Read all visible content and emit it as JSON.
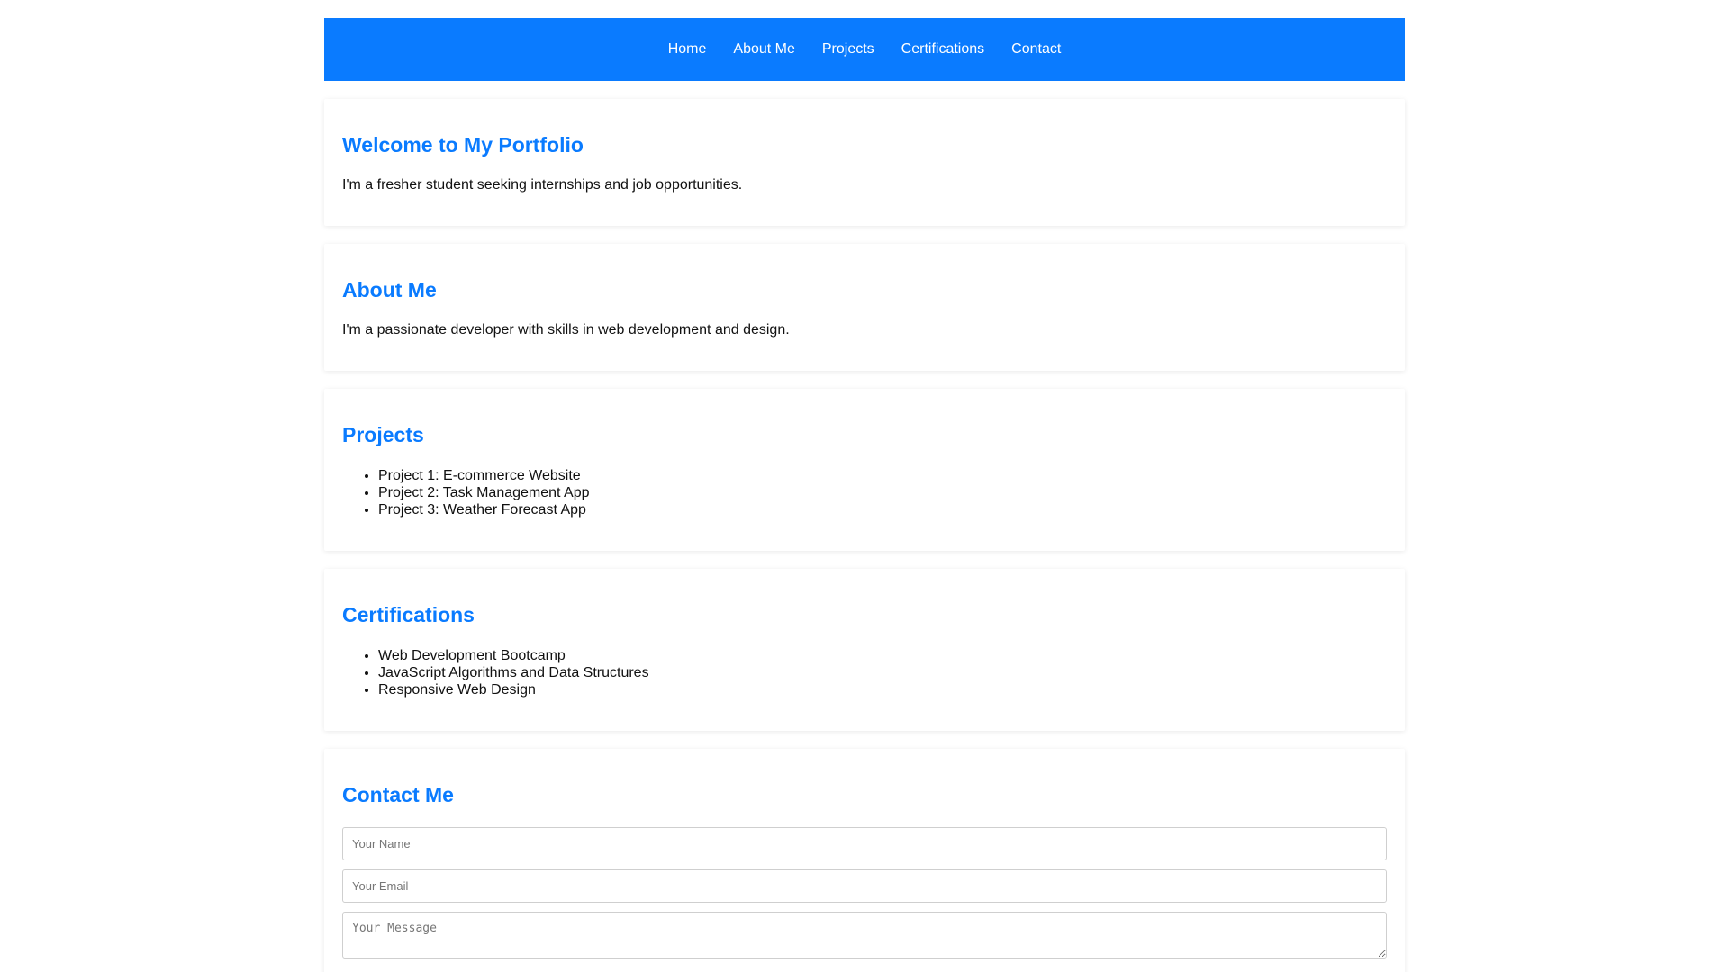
{
  "nav": {
    "items": [
      "Home",
      "About Me",
      "Projects",
      "Certifications",
      "Contact"
    ],
    "background": "#0a7bff"
  },
  "home": {
    "title": "Welcome to My Portfolio",
    "text": "I'm a fresher student seeking internships and job opportunities."
  },
  "about": {
    "title": "About Me",
    "text": "I'm a passionate developer with skills in web development and design."
  },
  "projects": {
    "title": "Projects",
    "items": [
      "Project 1: E-commerce Website",
      "Project 2: Task Management App",
      "Project 3: Weather Forecast App"
    ]
  },
  "certifications": {
    "title": "Certifications",
    "items": [
      "Web Development Bootcamp",
      "JavaScript Algorithms and Data Structures",
      "Responsive Web Design"
    ]
  },
  "contact": {
    "title": "Contact Me",
    "name_placeholder": "Your Name",
    "email_placeholder": "Your Email",
    "message_placeholder": "Your Message"
  },
  "colors": {
    "accent": "#0a7bff",
    "text": "#111111"
  }
}
